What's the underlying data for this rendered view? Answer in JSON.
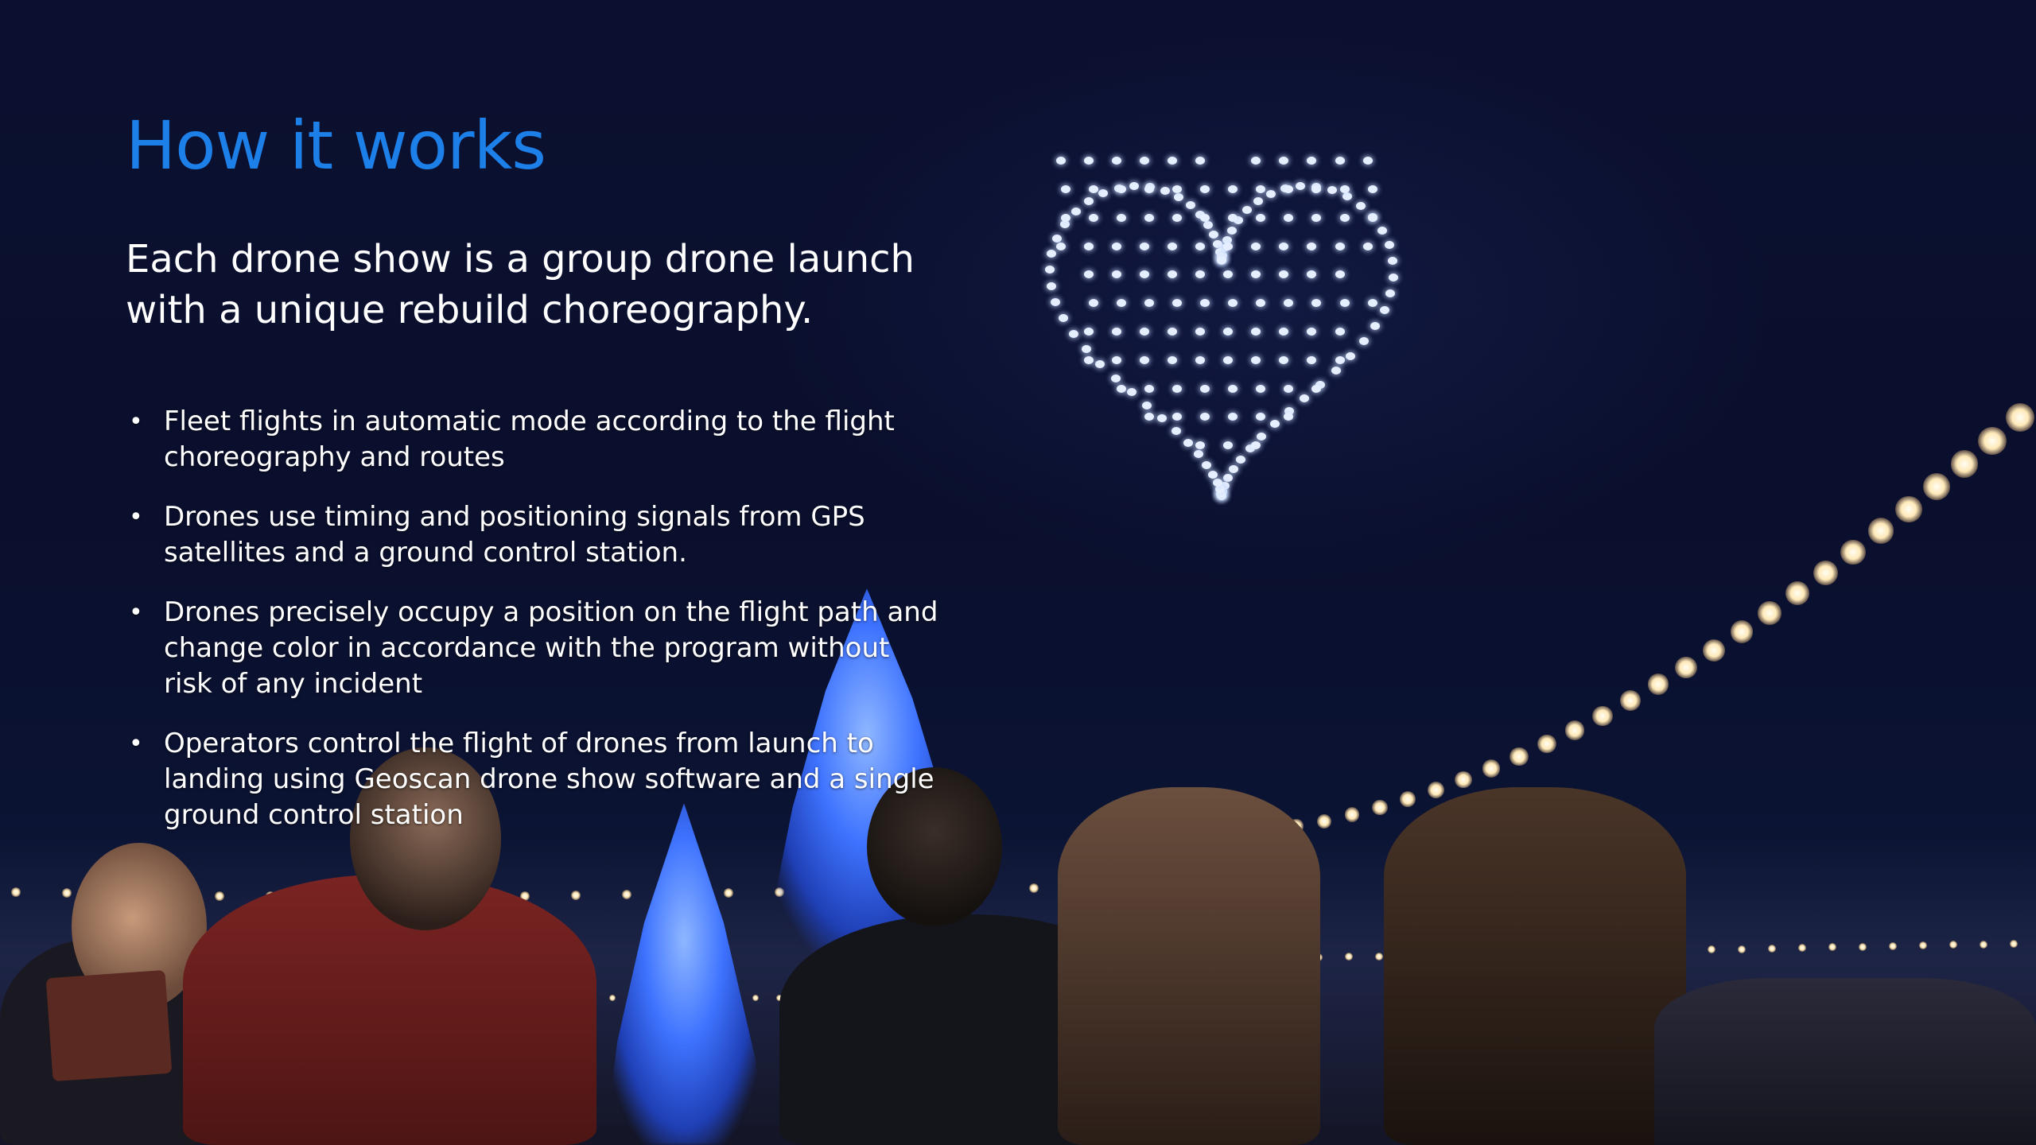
{
  "slide": {
    "title": "How it works",
    "subtitle": "Each drone show is a group drone launch with a unique rebuild choreography.",
    "bullets": [
      "Fleet flights in automatic mode according to the flight choreography and routes",
      "Drones use timing and positioning signals from GPS satellites and a ground control station.",
      "Drones precisely occupy a position on the flight path and change color in accordance with the program without risk of any incident",
      "Operators control the flight of drones from launch to landing using Geoscan drone show software and a single ground control station"
    ],
    "bullet_symbol": "•"
  },
  "colors": {
    "title": "#1d7fe8",
    "text": "#ffffff",
    "sky": "#0a0f2d"
  },
  "background": {
    "scene": "night crowd watching drone heart formation",
    "icons": [
      "heart-drone-formation",
      "string-lights",
      "illuminated-trees"
    ]
  }
}
